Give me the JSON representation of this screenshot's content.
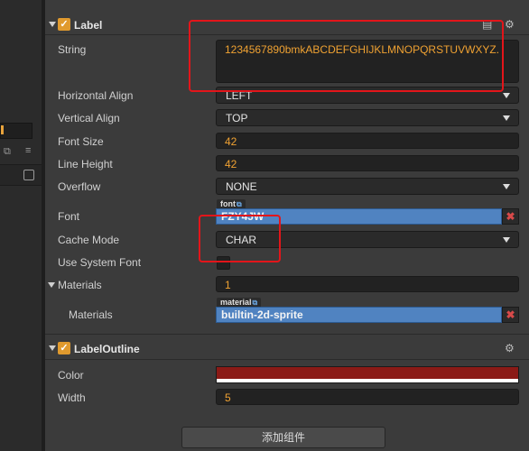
{
  "label_section": {
    "title": "Label",
    "enabled_check": "✓",
    "string_label": "String",
    "string_value": "1234567890bmkABCDEFGHIJKLMNOPQRSTUVWXYZ.",
    "horizontal_align_label": "Horizontal Align",
    "horizontal_align_value": "LEFT",
    "vertical_align_label": "Vertical Align",
    "vertical_align_value": "TOP",
    "font_size_label": "Font Size",
    "font_size_value": "42",
    "line_height_label": "Line Height",
    "line_height_value": "42",
    "overflow_label": "Overflow",
    "overflow_value": "NONE",
    "font_label": "Font",
    "font_tag": "font",
    "font_value": "FZY4JW",
    "cache_mode_label": "Cache Mode",
    "cache_mode_value": "CHAR",
    "use_system_font_label": "Use System Font",
    "materials_label": "Materials",
    "materials_count": "1",
    "material_item_label": "Materials",
    "material_tag": "material",
    "material_value": "builtin-2d-sprite"
  },
  "outline_section": {
    "title": "LabelOutline",
    "enabled_check": "✓",
    "color_label": "Color",
    "color_value": "#8b1a16",
    "width_label": "Width",
    "width_value": "5"
  },
  "add_component_label": "添加组件",
  "icons": {
    "link": "⧉",
    "clear": "✖",
    "gear": "⚙",
    "copy": "⧉",
    "menu": "≡",
    "dropdown": "▾",
    "save": "▤"
  },
  "colors": {
    "accent": "#e09a2e",
    "asset_blue": "#5083c1",
    "highlight_red": "#e3151a"
  }
}
